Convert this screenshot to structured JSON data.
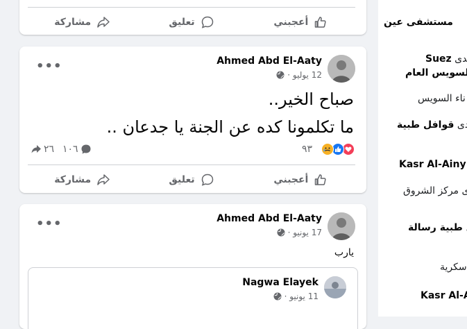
{
  "actions": {
    "like": "أعجبني",
    "comment": "تعليق",
    "share": "مشاركة"
  },
  "post1": {
    "author": "Ahmed Abd El-Aaty",
    "date": "12 يوليو ·",
    "line1": "صباح الخير..",
    "line2": "ما تكلمونا كده عن الجنة يا جدعان ..",
    "reactions_count": "٩٣",
    "comments_count": "١٠٦",
    "shares_count": "٢٦"
  },
  "post2": {
    "author": "Ahmed Abd El-Aaty",
    "date": "17 يونيو ·",
    "text": "يارب",
    "shared": {
      "author": "Nagwa Elayek",
      "date": "11 يونيو ·"
    }
  },
  "sidebar": {
    "item1": "مستشفى عين",
    "item2a_prefix": "لدى",
    "item2a_bold": "Suez",
    "item2b": "السويس العام",
    "item3": "ناء السويس",
    "item4_prefix": "لدى",
    "item4_bold": "قوافل طبية",
    "item5": "Kasr Al-Ainy M",
    "item6": "لدى مركز الشروق",
    "item7": "ل طبية رسالة",
    "item8": "سكرية",
    "item9": "Kasr Al-Ai"
  },
  "colors": {
    "like_blue": "#1877f2",
    "love_red": "#f33e58",
    "haha_yellow": "#f7b125",
    "muted": "#65676b"
  }
}
